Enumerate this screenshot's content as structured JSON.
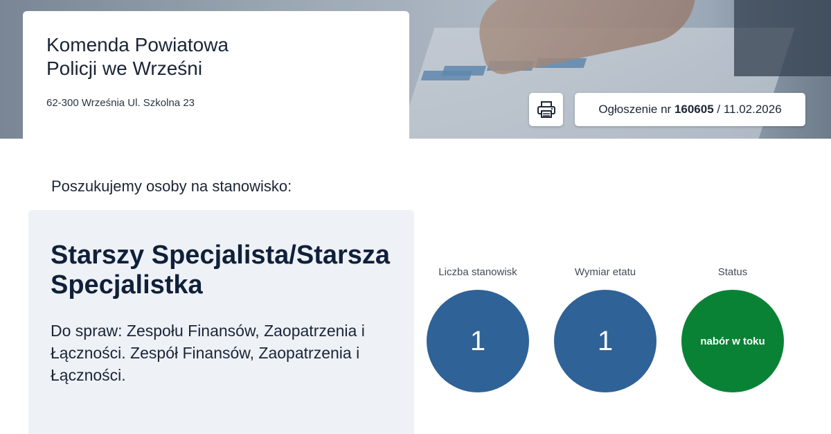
{
  "header": {
    "org_name_line1": "Komenda Powiatowa",
    "org_name_line2": "Policji we Wrześni",
    "address": "62-300 Września Ul. Szkolna 23"
  },
  "toolbar": {
    "print_icon": "printer-icon",
    "announcement_prefix": "Ogłoszenie nr",
    "announcement_number": "160605",
    "announcement_date": "/ 11.02.2026"
  },
  "main": {
    "search_heading": "Poszukujemy osoby na stanowisko:",
    "job_title": "Starszy Specjalista/Starsza Specjalistka",
    "job_description": "Do spraw: Zespołu Finansów, Zaopatrzenia i Łączności. Zespół Finansów, Zaopatrzenia i Łączności."
  },
  "stats": [
    {
      "label": "Liczba stanowisk",
      "value": "1",
      "color": "#2f6296"
    },
    {
      "label": "Wymiar etatu",
      "value": "1",
      "color": "#2f6296"
    },
    {
      "label": "Status",
      "value": "nabór w toku",
      "color": "#0a8236"
    }
  ]
}
